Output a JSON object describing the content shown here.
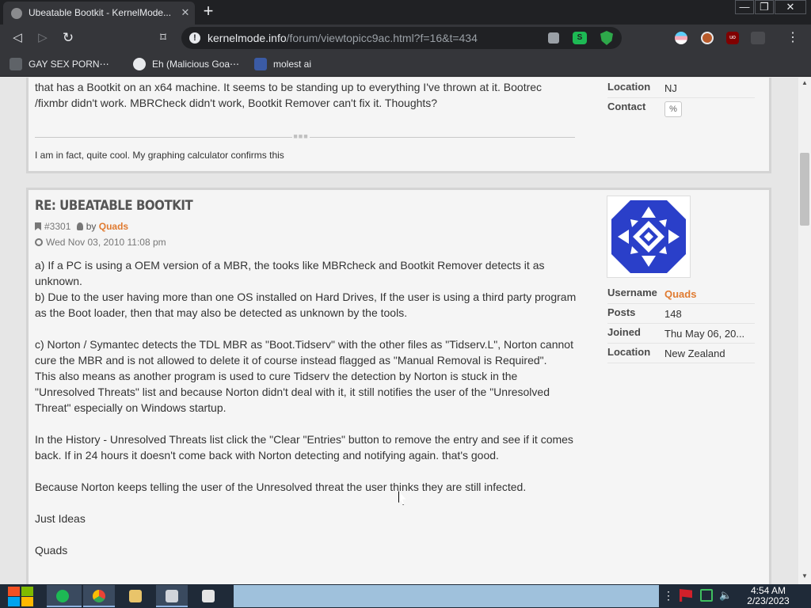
{
  "browser": {
    "tab_title": "Ubeatable Bootkit - KernelMode...",
    "tab_close": "✕",
    "new_tab": "+",
    "window_controls": {
      "minimize": "—",
      "maximize": "❐",
      "close": "✕"
    },
    "url_host": "kernelmode.info",
    "url_path": "/forum/viewtopicc9ac.html?f=16&t=434",
    "extension_label": "S",
    "ublock_label": "uo",
    "menu_icon": "⋮",
    "bookmarks": [
      {
        "label": "GAY SEX PORN⋯",
        "icon": "page-icon"
      },
      {
        "label": "Eh (Malicious Goa⋯",
        "icon": "globe-icon"
      },
      {
        "label": "molest ai",
        "icon": "app-icon"
      }
    ]
  },
  "previous_post": {
    "body": "that has a Bootkit on an x64 machine. It seems to be standing up to everything I've thrown at it. Bootrec /fixmbr didn't work. MBRCheck didn't work, Bootkit Remover can't fix it. Thoughts?",
    "signature": "I am in fact, quite cool. My graphing calculator confirms this",
    "profile": [
      {
        "label": "Location",
        "value": "NJ"
      },
      {
        "label": "Contact",
        "value": ""
      }
    ]
  },
  "post": {
    "title": "Re: Ubeatable Bootkit",
    "post_number": "#3301",
    "by": "by",
    "author": "Quads",
    "date": "Wed Nov 03, 2010 11:08 pm",
    "body": [
      "a) If a PC is using a OEM version of a MBR, the tooks like MBRcheck and Bootkit Remover detects it as unknown.",
      "b) Due to the user having more than one OS installed on Hard Drives, If the user is using a third party program as the Boot loader, then that may also be detected as unknown by the tools.",
      "",
      "c) Norton / Symantec detects the TDL MBR as \"Boot.Tidserv\" with the other files as \"Tidserv.L\", Norton cannot cure the MBR and is not allowed to delete it of course instead flagged as \"Manual Removal is Required\".",
      "This also means as another program is used to cure Tidserv the detection by Norton is stuck in the \"Unresolved Threats\" list and because Norton didn't deal with it, it still notifies the user of the \"Unresolved Threat\" especially on Windows startup.",
      "",
      "In the History - Unresolved Threats list click the \"Clear \"Entries\" button to remove the entry and see if it comes back. If in 24 hours it doesn't come back with Norton detecting and notifying again. that's good.",
      "",
      "Because Norton keeps telling the user of the Unresolved threat the user thinks they are still infected.",
      "",
      "Just Ideas",
      "",
      "Quads"
    ],
    "profile": [
      {
        "label": "Username",
        "value": "Quads"
      },
      {
        "label": "Posts",
        "value": "148"
      },
      {
        "label": "Joined",
        "value": "Thu May 06, 20..."
      },
      {
        "label": "Location",
        "value": "New Zealand"
      }
    ]
  },
  "taskbar": {
    "time": "4:54 AM",
    "date": "2/23/2023",
    "tray_more": "⋮",
    "volume_icon": "🔈"
  },
  "colors": {
    "accent_link": "#e07b31",
    "browser_dark": "#35363a",
    "avatar_blue": "#2a3fc9"
  }
}
